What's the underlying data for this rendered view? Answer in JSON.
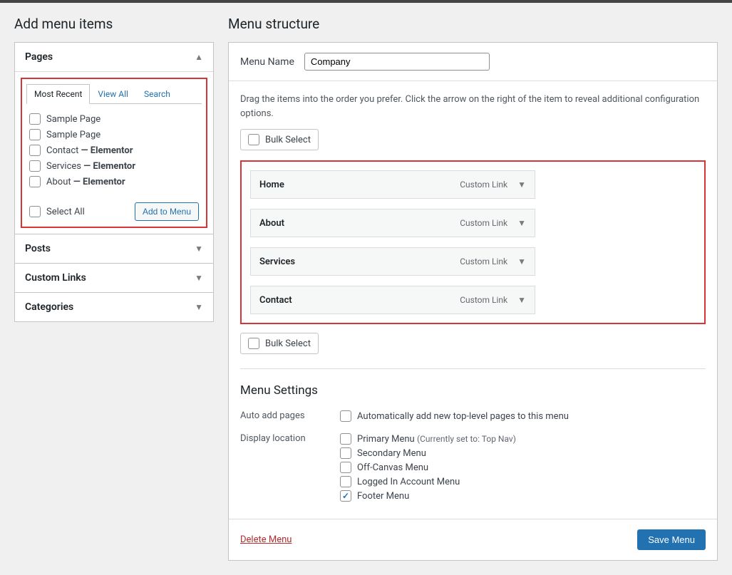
{
  "left": {
    "title": "Add menu items",
    "pages_box": {
      "title": "Pages",
      "tabs": {
        "most_recent": "Most Recent",
        "view_all": "View All",
        "search": "Search"
      },
      "items": [
        {
          "label": "Sample Page",
          "suffix": ""
        },
        {
          "label": "Sample Page",
          "suffix": ""
        },
        {
          "label": "Contact",
          "suffix": " — Elementor"
        },
        {
          "label": "Services",
          "suffix": " — Elementor"
        },
        {
          "label": "About",
          "suffix": " — Elementor"
        }
      ],
      "select_all": "Select All",
      "add_to_menu": "Add to Menu"
    },
    "collapsed": {
      "posts": "Posts",
      "custom_links": "Custom Links",
      "categories": "Categories"
    }
  },
  "right": {
    "title": "Menu structure",
    "menu_name_label": "Menu Name",
    "menu_name_value": "Company",
    "instructions": "Drag the items into the order you prefer. Click the arrow on the right of the item to reveal additional configuration options.",
    "bulk_select": "Bulk Select",
    "menu_items": [
      {
        "title": "Home",
        "type": "Custom Link"
      },
      {
        "title": "About",
        "type": "Custom Link"
      },
      {
        "title": "Services",
        "type": "Custom Link"
      },
      {
        "title": "Contact",
        "type": "Custom Link"
      }
    ],
    "settings": {
      "heading": "Menu Settings",
      "auto_add_label": "Auto add pages",
      "auto_add_text": "Automatically add new top-level pages to this menu",
      "display_label": "Display location",
      "locations": [
        {
          "label": "Primary Menu",
          "note": "(Currently set to: Top Nav)",
          "checked": false
        },
        {
          "label": "Secondary Menu",
          "note": "",
          "checked": false
        },
        {
          "label": "Off-Canvas Menu",
          "note": "",
          "checked": false
        },
        {
          "label": "Logged In Account Menu",
          "note": "",
          "checked": false
        },
        {
          "label": "Footer Menu",
          "note": "",
          "checked": true
        }
      ]
    },
    "delete_menu": "Delete Menu",
    "save_menu": "Save Menu"
  }
}
